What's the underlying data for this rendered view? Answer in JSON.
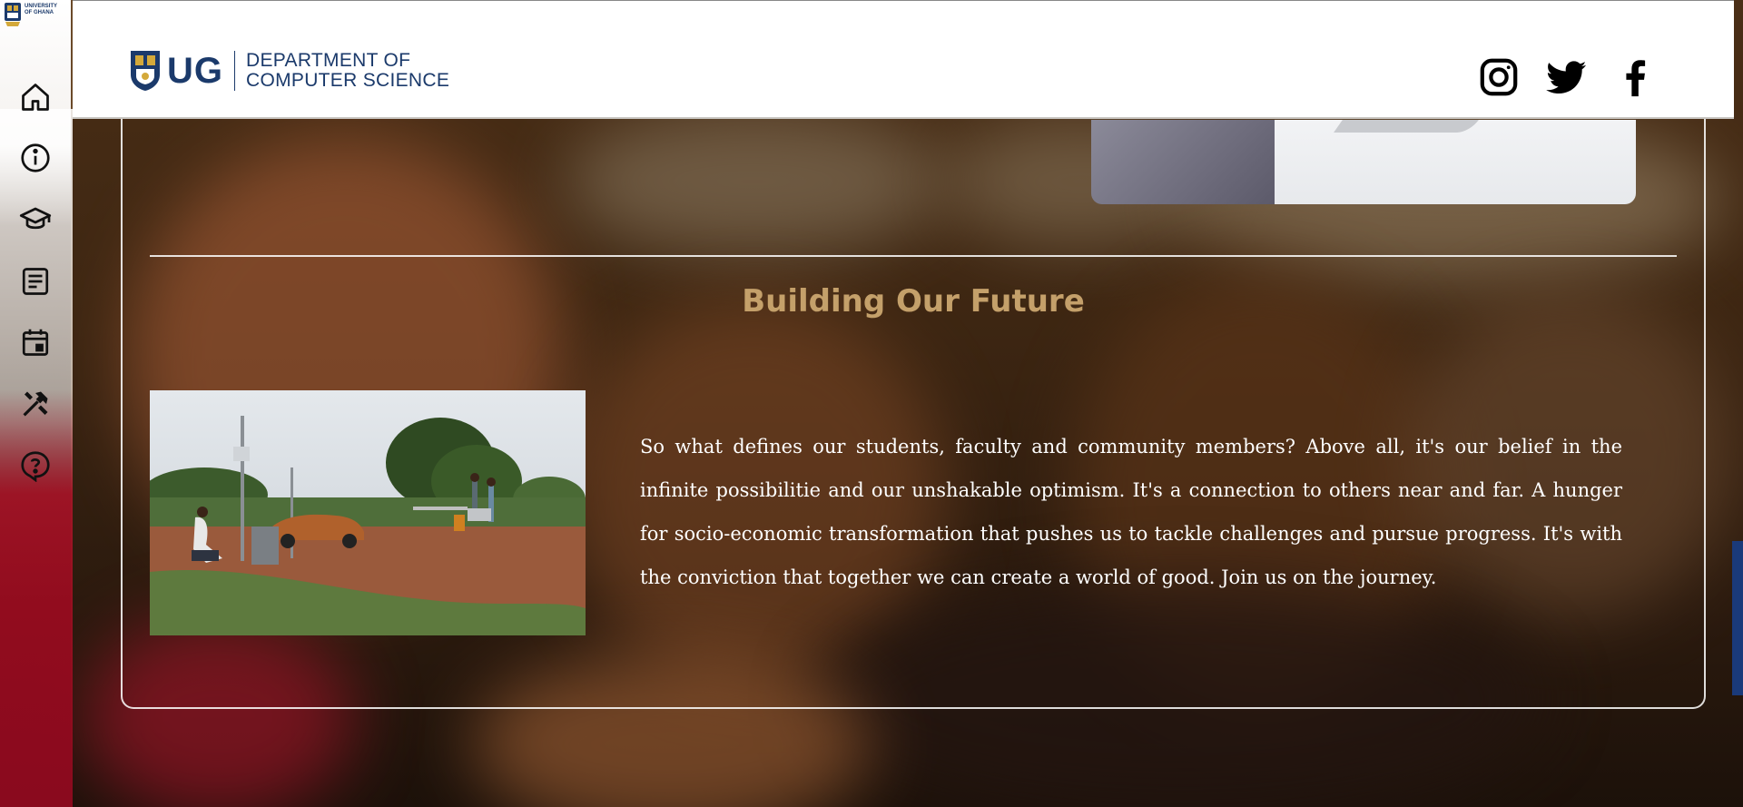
{
  "sidebar": {
    "logo_text_line1": "UNIVERSITY",
    "logo_text_line2": "OF GHANA",
    "items": [
      {
        "icon": "home-icon"
      },
      {
        "icon": "info-icon"
      },
      {
        "icon": "graduation-cap-icon"
      },
      {
        "icon": "article-icon"
      },
      {
        "icon": "calendar-event-icon"
      },
      {
        "icon": "tools-icon"
      },
      {
        "icon": "help-bubble-icon"
      }
    ]
  },
  "header": {
    "brand_short": "UG",
    "dept_line1": "DEPARTMENT OF",
    "dept_line2": "COMPUTER SCIENCE",
    "social": [
      "instagram-icon",
      "twitter-icon",
      "facebook-icon"
    ]
  },
  "section": {
    "title": "Building Our Future",
    "body": "So what defines our students, faculty and community members? Above all, it's our belief in the infinite possibilitie and our unshakable optimism. It's a connection to others near and far. A hunger for socio-economic transformation that pushes us to tackle challenges and pursue progress. It's with the conviction that together we can create a world of good. Join us on the journey."
  },
  "colors": {
    "brand_blue": "#1b3a6b",
    "title_gold": "#c4a06a",
    "text_white": "#ffffff"
  }
}
